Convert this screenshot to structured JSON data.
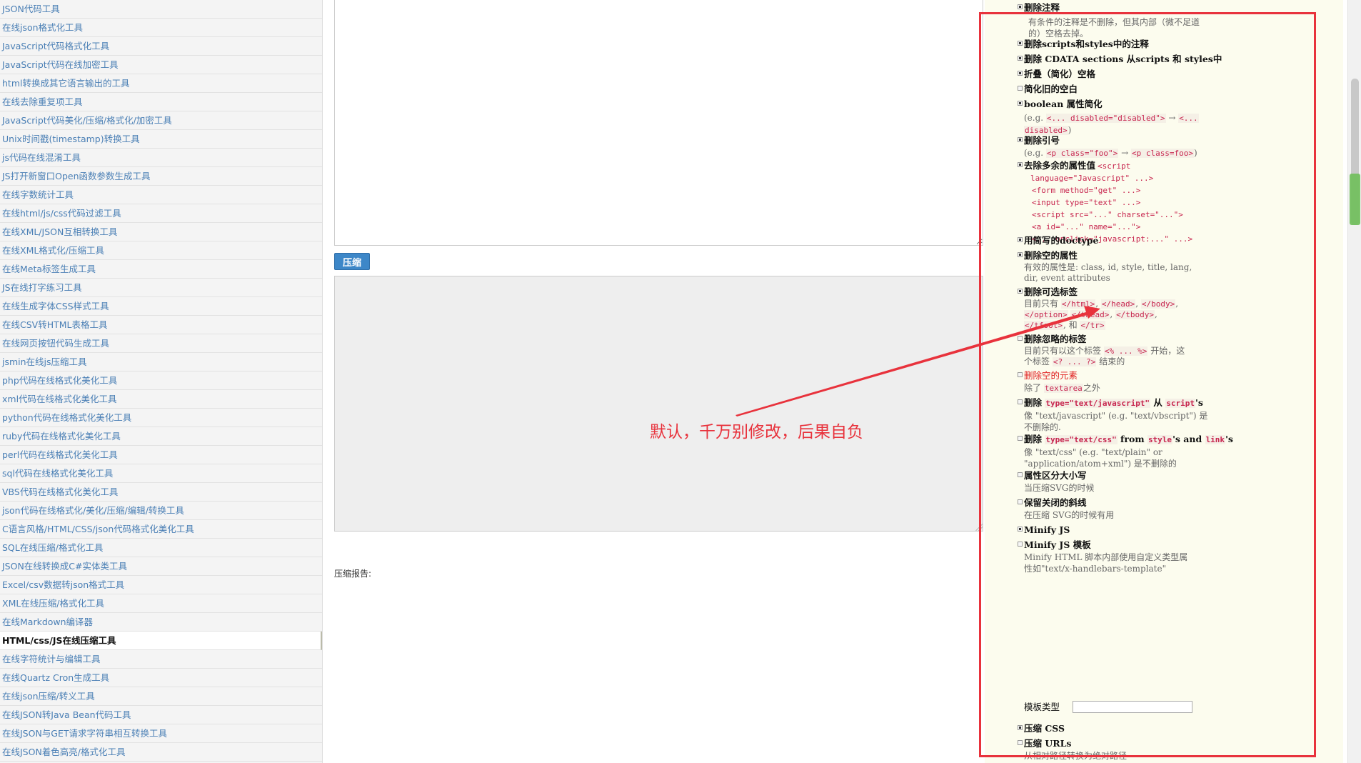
{
  "sidebar": {
    "items": [
      "JSON代码工具",
      "在线json格式化工具",
      "JavaScript代码格式化工具",
      "JavaScript代码在线加密工具",
      "html转换成其它语言输出的工具",
      "在线去除重复项工具",
      "JavaScript代码美化/压缩/格式化/加密工具",
      "Unix时间戳(timestamp)转换工具",
      "js代码在线混淆工具",
      "JS打开新窗口Open函数参数生成工具",
      "在线字数统计工具",
      "在线html/js/css代码过滤工具",
      "在线XML/JSON互相转换工具",
      "在线XML格式化/压缩工具",
      "在线Meta标签生成工具",
      "JS在线打字练习工具",
      "在线生成字体CSS样式工具",
      "在线CSV转HTML表格工具",
      "在线网页按钮代码生成工具",
      "jsmin在线js压缩工具",
      "php代码在线格式化美化工具",
      "xml代码在线格式化美化工具",
      "python代码在线格式化美化工具",
      "ruby代码在线格式化美化工具",
      "perl代码在线格式化美化工具",
      "sql代码在线格式化美化工具",
      "VBS代码在线格式化美化工具",
      "json代码在线格式化/美化/压缩/编辑/转换工具",
      "C语言风格/HTML/CSS/json代码格式化美化工具",
      "SQL在线压缩/格式化工具",
      "JSON在线转换成C#实体类工具",
      "Excel/csv数据转json格式工具",
      "XML在线压缩/格式化工具",
      "在线Markdown编译器",
      "HTML/css/JS在线压缩工具",
      "在线字符统计与编辑工具",
      "在线Quartz Cron生成工具",
      "在线json压缩/转义工具",
      "在线JSON转Java Bean代码工具",
      "在线JSON与GET请求字符串相互转换工具",
      "在线JSON着色高亮/格式化工具"
    ],
    "active_index": 34
  },
  "main": {
    "compress_button": "压缩",
    "report_label": "压缩报告:"
  },
  "options": {
    "remove_comments": "删除注释",
    "remove_comments_desc1": "有条件的注释是不删除，但其内部（微不足道",
    "remove_comments_desc2": "的）空格去掉。",
    "remove_script_comments": "删除scripts和styles中的注释",
    "remove_cdata": "删除 CDATA sections 从scripts 和 styles中",
    "collapse_ws": "折叠（简化）空格",
    "conservative_collapse": "简化旧的空白",
    "collapse_boolean": "boolean 属性简化",
    "collapse_boolean_desc_pre": "(e.g. ",
    "collapse_boolean_code1": "<... disabled=\"disabled\">",
    "arrow": " → ",
    "collapse_boolean_code2a": "<...",
    "collapse_boolean_code2b": "disabled>",
    "paren_close": ")",
    "remove_quotes": "删除引号",
    "remove_quotes_code1": "<p class=\"foo\">",
    "remove_quotes_code2": "<p class=foo>",
    "remove_redundant": "去除多余的属性值",
    "remove_redundant_code0": "<script",
    "remove_redundant_codes": [
      "language=\"Javascript\" ...>",
      "<form method=\"get\" ...>",
      "<input type=\"text\" ...>",
      "<script src=\"...\" charset=\"...\">",
      "<a id=\"...\" name=\"...\">",
      "<... onclick=\"javascript:...\" ...>"
    ],
    "short_doctype": "用简写的doctype",
    "remove_empty_attrs": "删除空的属性",
    "remove_empty_attrs_desc1": "有效的属性是: class, id, style, title, lang,",
    "remove_empty_attrs_desc2": "dir, event attributes",
    "remove_optional": "删除可选标签",
    "remove_optional_pre": "目前只有 ",
    "remove_optional_codes1": [
      "</html>",
      "</head>",
      "</body>"
    ],
    "remove_optional_codes2": [
      "</option>",
      "</thead>",
      "</tbody>"
    ],
    "remove_optional_code3": "</tfoot>",
    "and_word": ", 和 ",
    "remove_optional_code4": "</tr>",
    "sep_comma": ", ",
    "sep_comma_end": ",",
    "remove_ignored": "删除忽略的标签",
    "remove_ignored_pre": "目前只有以这个标签 ",
    "remove_ignored_code1": "<% ... %>",
    "remove_ignored_mid": " 开始，这",
    "remove_ignored_pre2": "个标签 ",
    "remove_ignored_code2": "<? ... ?>",
    "remove_ignored_end": " 结束的",
    "remove_empty_elements": "删除空的元素",
    "remove_empty_elements_pre": "除了 ",
    "remove_empty_elements_code": "textarea",
    "remove_empty_elements_end": "之外",
    "remove_script_type_pre": "删除 ",
    "remove_script_type_code": "type=\"text/javascript\"",
    "remove_script_type_mid": " 从 ",
    "remove_script_type_code2": "script",
    "possessive": "'s",
    "remove_script_type_desc1": "像 \"text/javascript\" (e.g. \"text/vbscript\") 是",
    "remove_script_type_desc2": "不删除的.",
    "remove_style_type_code": "type=\"text/css\"",
    "remove_style_type_mid": " from ",
    "remove_style_type_code2": "style",
    "remove_style_type_and": "'s and ",
    "remove_style_type_code3": "link",
    "remove_style_type_desc1": "像 \"text/css\" (e.g. \"text/plain\" or",
    "remove_style_type_desc2": "\"application/atom+xml\") 是不删除的",
    "case_sensitive": "属性区分大小写",
    "case_sensitive_desc": "当压缩SVG的时候",
    "keep_closing_slash": "保留关闭的斜线",
    "keep_closing_slash_desc": "在压缩 SVG的时候有用",
    "minify_js": "Minify JS",
    "minify_js_templates": "Minify JS 模板",
    "minify_js_templates_desc1": "Minify HTML 脚本内部使用自定义类型属",
    "minify_js_templates_desc2": "性如\"text/x-handlebars-template\"",
    "template_type_label": "模板类型",
    "compress_css": "压缩 CSS",
    "compress_urls": "压缩 URLs",
    "compress_urls_desc": "从相对路径转换为绝对路径"
  },
  "annotation": {
    "text": "默认，千万别修改，后果自负",
    "color": "#e8323c"
  }
}
